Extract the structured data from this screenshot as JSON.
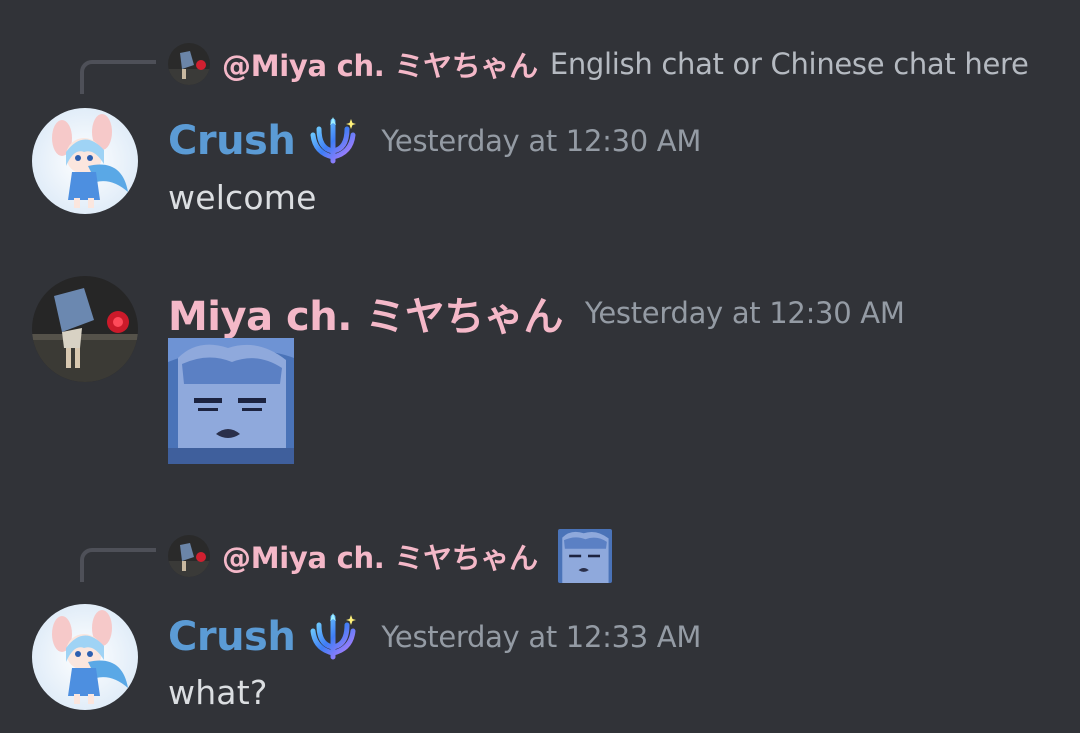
{
  "messages": [
    {
      "reply": {
        "mention": "@Miya ch. ミヤちゃん",
        "text": "English chat or Chinese chat here"
      },
      "author": "Crush",
      "timestamp": "Yesterday at 12:30 AM",
      "content": "welcome"
    },
    {
      "author": "Miya ch. ミヤちゃん",
      "timestamp": "Yesterday at 12:30 AM",
      "attachment": "sticker-image"
    },
    {
      "reply": {
        "mention": "@Miya ch. ミヤちゃん",
        "attachment": "sticker-thumbnail"
      },
      "author": "Crush",
      "timestamp": "Yesterday at 12:33 AM",
      "content": "what?"
    }
  ],
  "colors": {
    "background": "#313338",
    "crush_name": "#5b9bd5",
    "miya_name": "#f4b8c8",
    "timestamp": "#949ba4",
    "text": "#dbdee1"
  },
  "icons": {
    "badge": "trident-badge-icon"
  }
}
